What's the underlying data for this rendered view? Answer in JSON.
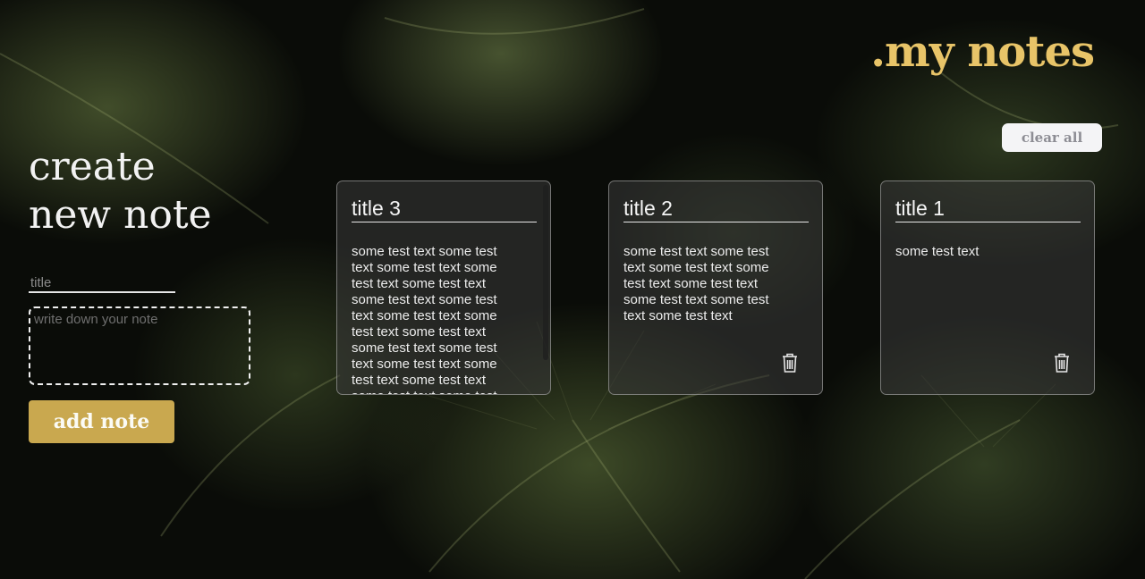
{
  "header": {
    "brand": ".my notes",
    "clear_all_label": "clear all"
  },
  "create_form": {
    "heading_line1": "create",
    "heading_line2": "new note",
    "title_placeholder": "title",
    "note_placeholder": "write down your note",
    "add_button_label": "add note"
  },
  "notes": [
    {
      "title": "title 3",
      "body": "some test text some test text some test text some test text some test text some test text some test text some test text some test text some test text some test text some test text some test text some test text some test text some test text some test text some test text"
    },
    {
      "title": "title 2",
      "body": "some test text some test text some test text some test text some test text some test text some test text some test text"
    },
    {
      "title": "title 1",
      "body": "some test text"
    }
  ],
  "icons": {
    "delete": "trash-icon"
  },
  "colors": {
    "accent": "#e8c468",
    "button": "#c9a84f",
    "card": "#3a3a3a"
  }
}
